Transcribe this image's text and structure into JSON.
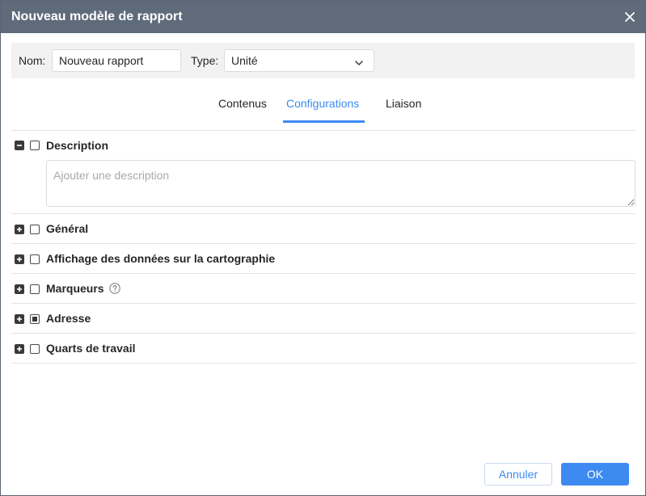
{
  "dialog": {
    "title": "Nouveau modèle de rapport",
    "close_icon": "close-icon"
  },
  "form": {
    "name_label": "Nom:",
    "name_value": "Nouveau rapport",
    "type_label": "Type:",
    "type_value": "Unité"
  },
  "tabs": [
    {
      "label": "Contenus",
      "active": false
    },
    {
      "label": "Configurations",
      "active": true
    },
    {
      "label": "Liaison",
      "active": false
    }
  ],
  "sections": [
    {
      "title": "Description",
      "expanded": true,
      "checked": false
    },
    {
      "title": "Général",
      "expanded": false,
      "checked": false
    },
    {
      "title": "Affichage des données sur la cartographie",
      "expanded": false,
      "checked": false
    },
    {
      "title": "Marqueurs",
      "expanded": false,
      "checked": false,
      "has_help": true
    },
    {
      "title": "Adresse",
      "expanded": false,
      "checked": "partial"
    },
    {
      "title": "Quarts de travail",
      "expanded": false,
      "checked": false
    }
  ],
  "description": {
    "placeholder": "Ajouter une description",
    "value": ""
  },
  "footer": {
    "cancel_label": "Annuler",
    "ok_label": "OK"
  },
  "colors": {
    "titlebar": "#5f6b7a",
    "accent": "#3d8af1",
    "toolbar_bg": "#f2f2f2"
  }
}
